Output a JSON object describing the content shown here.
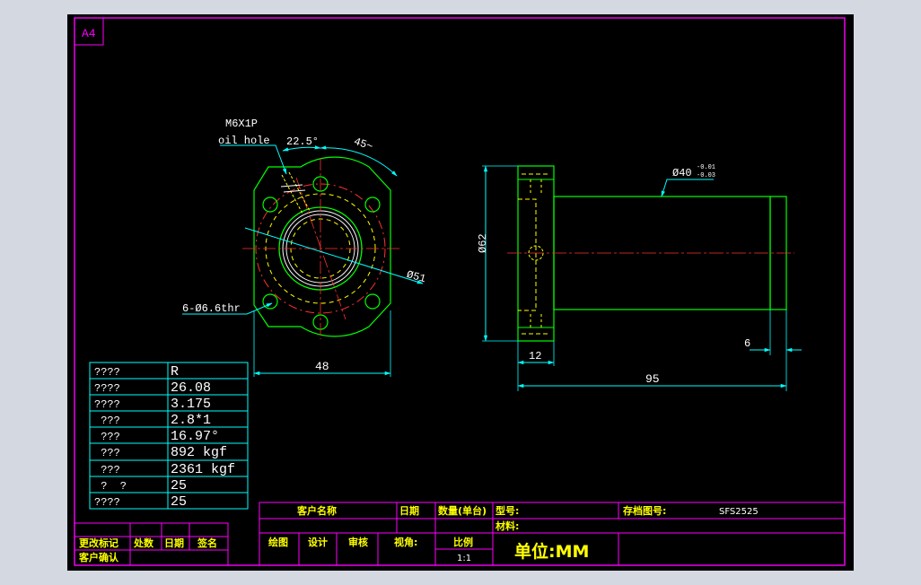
{
  "sheet": {
    "size_label": "A4"
  },
  "front_view": {
    "thread_label": "M6X1P",
    "oil_label": "oil hole",
    "angle_small": "22.5°",
    "angle_large": "45~",
    "pcd_label": "Ø51",
    "holes_label": "6-Ø6.6thr",
    "width_label": "48"
  },
  "side_view": {
    "flange_dia": "Ø62",
    "shaft_dia": "Ø40",
    "tol_upper": "-0.01",
    "tol_lower": "-0.03",
    "flange_thk": "12",
    "end_width": "6",
    "overall_length": "95"
  },
  "spec_table": [
    {
      "k": "????",
      "v": "R"
    },
    {
      "k": "????",
      "v": "26.08"
    },
    {
      "k": "????",
      "v": "3.175"
    },
    {
      "k": " ???",
      "v": "2.8*1"
    },
    {
      "k": " ???",
      "v": "16.97°"
    },
    {
      "k": " ???",
      "v": "892 kgf"
    },
    {
      "k": " ???",
      "v": "2361 kgf"
    },
    {
      "k": " ?  ?",
      "v": "25"
    },
    {
      "k": "????",
      "v": "25"
    }
  ],
  "title_block": {
    "customer_name": "客户名称",
    "date": "日期",
    "qty": "数量(单台)",
    "model": "型号:",
    "archive_no": "存档图号:",
    "archive_value": "SFS2525",
    "material": "材料:",
    "drawn": "绘图",
    "design": "设计",
    "review": "审核",
    "view_angle": "视角:",
    "scale_label": "比例",
    "scale_value": "1:1",
    "unit": "单位:MM"
  },
  "revision_block": {
    "change_mark": "更改标记",
    "location": "处数",
    "date": "日期",
    "signature": "签名",
    "customer_confirm": "客户确认"
  }
}
